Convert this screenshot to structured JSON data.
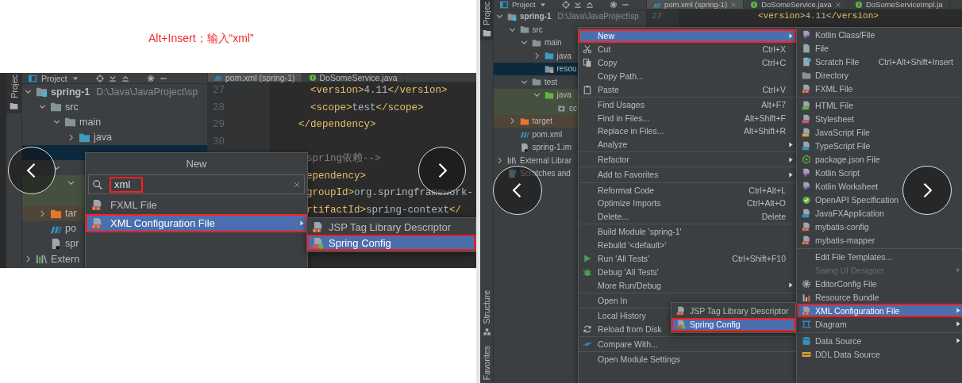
{
  "annotation": "Alt+Insert；输入“xml”",
  "left_screenshot": {
    "tool_window_tabs": [
      {
        "label": "Projec",
        "kind": "project",
        "selected": true
      }
    ],
    "panel_title": "Project",
    "tree": [
      {
        "label": "spring-1",
        "path": "D:\\Java\\JavaProject\\sp",
        "kind": "module",
        "expanded": true,
        "selected": false,
        "children": [
          {
            "label": "src",
            "kind": "folder",
            "expanded": true,
            "selected": false,
            "children": [
              {
                "label": "main",
                "kind": "folder",
                "expanded": true,
                "selected": false,
                "children": [
                  {
                    "label": "java",
                    "kind": "source",
                    "expanded": false,
                    "selected": false
                  },
                  {
                    "selected": true
                  }
                ]
              },
              {
                "expanded": true,
                "selected": false,
                "children": [
                  {
                    "kind": "test-source",
                    "expanded": true,
                    "selected": false,
                    "children": [
                      {
                        "selected": false
                      }
                    ]
                  }
                ]
              }
            ]
          },
          {
            "label": "tar",
            "kind": "excluded",
            "expanded": false,
            "selected": false
          },
          {
            "label": "po",
            "kind": "build-file",
            "selected": false
          },
          {
            "label": "spr",
            "kind": "module-file",
            "selected": false
          }
        ]
      },
      {
        "label": "Extern",
        "kind": "library",
        "expanded": false,
        "selected": false
      }
    ],
    "editor_tabs": [
      {
        "label": "pom.xml (spring-1)",
        "kind": "build-file",
        "selected": true
      },
      {
        "label": "DoSomeService.java",
        "kind": "class",
        "selected": false
      }
    ],
    "line_numbers": [
      "27",
      "28",
      "29",
      "30"
    ],
    "code_lines": [
      {
        "kind": "code",
        "tokens": [
          {
            "text": "  <version>",
            "kind": "tag"
          },
          {
            "text": "4.11",
            "kind": "text"
          },
          {
            "text": "</version>",
            "kind": "tag"
          }
        ]
      },
      {
        "kind": "code",
        "tokens": [
          {
            "text": "  <scope>",
            "kind": "tag"
          },
          {
            "text": "test",
            "kind": "text"
          },
          {
            "text": "</scope>",
            "kind": "tag"
          }
        ]
      },
      {
        "kind": "code",
        "tokens": [
          {
            "text": "</dependency>",
            "kind": "tag"
          }
        ]
      },
      {
        "kind": "blank"
      },
      {
        "kind": "partial",
        "tokens": [
          {
            "text": "spring依赖-->",
            "kind": "comment"
          }
        ]
      },
      {
        "kind": "partial",
        "tokens": [
          {
            "text": "ependency>",
            "kind": "tag"
          }
        ]
      },
      {
        "kind": "partial",
        "tokens": [
          {
            "text": "groupId>",
            "kind": "tag"
          },
          {
            "text": "org.springframework-",
            "kind": "text"
          }
        ]
      },
      {
        "kind": "partial",
        "tokens": [
          {
            "text": "rtifactId>",
            "kind": "tag"
          },
          {
            "text": "spring-context",
            "kind": "text"
          },
          {
            "text": "</",
            "kind": "tag"
          }
        ]
      }
    ],
    "new_popup": {
      "title": "New",
      "search": {
        "value": "xml",
        "outlined": true
      },
      "items": [
        {
          "label": "FXML File",
          "kind": "xml",
          "selected": false
        },
        {
          "label": "XML Configuration File",
          "kind": "xml",
          "submenu": true,
          "selected": true,
          "outlined": true
        }
      ]
    },
    "submenu": {
      "items": [
        {
          "label": "JSP Tag Library Descriptor",
          "kind": "xml",
          "selected": false
        },
        {
          "label": "Spring Config",
          "kind": "spring",
          "selected": true,
          "outlined": true
        }
      ]
    },
    "nav_buttons": [
      {
        "kind": "previous"
      },
      {
        "kind": "next"
      }
    ]
  },
  "right_screenshot": {
    "tool_window_tabs": [
      {
        "label": "Projec",
        "kind": "project",
        "selected": true
      },
      {
        "label": "Structure",
        "kind": "structure",
        "selected": false
      },
      {
        "label": "Favorites",
        "kind": "favorites",
        "selected": false
      }
    ],
    "panel_title": "Project",
    "tree": [
      {
        "label": "spring-1",
        "path": "D:\\Java\\JavaProject\\sp",
        "kind": "module",
        "expanded": true,
        "selected": false,
        "children": [
          {
            "label": "src",
            "kind": "folder",
            "expanded": true,
            "selected": false,
            "children": [
              {
                "label": "main",
                "kind": "folder",
                "expanded": true,
                "selected": false,
                "children": [
                  {
                    "label": "java",
                    "kind": "source",
                    "expanded": false,
                    "selected": false
                  },
                  {
                    "label": "resou",
                    "kind": "resources",
                    "selected": true
                  }
                ]
              },
              {
                "label": "test",
                "kind": "folder",
                "expanded": true,
                "selected": false,
                "children": [
                  {
                    "label": "java",
                    "kind": "test-source",
                    "expanded": true,
                    "selected": false,
                    "children": [
                      {
                        "label": "cc",
                        "kind": "package",
                        "selected": false
                      }
                    ]
                  }
                ]
              }
            ]
          },
          {
            "label": "target",
            "kind": "excluded",
            "expanded": false,
            "selected": false
          },
          {
            "label": "pom.xml",
            "kind": "build-file",
            "selected": false
          },
          {
            "label": "spring-1.im",
            "kind": "module-file",
            "selected": false
          }
        ]
      },
      {
        "label": "External Librar",
        "kind": "library",
        "expanded": false,
        "selected": false
      },
      {
        "label": "Scratches and",
        "kind": "scratches",
        "selected": false
      }
    ],
    "editor_tabs": [
      {
        "label": "pom.xml (spring-1)",
        "kind": "build-file",
        "selected": true,
        "closable": true
      },
      {
        "label": "DoSomeService.java",
        "kind": "class",
        "selected": false,
        "closable": true
      },
      {
        "label": "DoSomeServiceImpl.ja",
        "kind": "class",
        "selected": false
      }
    ],
    "line_numbers": [
      "27"
    ],
    "code_lines": [
      {
        "kind": "code",
        "tokens": [
          {
            "text": "<version>",
            "kind": "tag"
          },
          {
            "text": "4.11",
            "kind": "text"
          },
          {
            "text": "</version>",
            "kind": "tag"
          }
        ]
      }
    ],
    "context_menu": {
      "items": [
        {
          "label": "New",
          "kind": "plain",
          "submenu": true,
          "selected": true,
          "outlined": true
        },
        {
          "label": "Cut",
          "kind": "cut",
          "shortcut": "Ctrl+X",
          "selected": false
        },
        {
          "label": "Copy",
          "kind": "copy",
          "shortcut": "Ctrl+C",
          "selected": false
        },
        {
          "label": "Copy Path...",
          "kind": "plain",
          "selected": false
        },
        {
          "label": "Paste",
          "kind": "paste",
          "shortcut": "Ctrl+V",
          "selected": false
        },
        {
          "kind": "separator"
        },
        {
          "label": "Find Usages",
          "kind": "plain",
          "shortcut": "Alt+F7",
          "selected": false
        },
        {
          "label": "Find in Files...",
          "kind": "plain",
          "shortcut": "Alt+Shift+F",
          "selected": false
        },
        {
          "label": "Replace in Files...",
          "kind": "plain",
          "shortcut": "Alt+Shift+R",
          "selected": false
        },
        {
          "label": "Analyze",
          "kind": "plain",
          "submenu": true,
          "selected": false
        },
        {
          "kind": "separator"
        },
        {
          "label": "Refactor",
          "kind": "plain",
          "submenu": true,
          "selected": false
        },
        {
          "kind": "separator"
        },
        {
          "label": "Add to Favorites",
          "kind": "plain",
          "submenu": true,
          "selected": false
        },
        {
          "kind": "separator"
        },
        {
          "label": "Reformat Code",
          "kind": "plain",
          "shortcut": "Ctrl+Alt+L",
          "selected": false
        },
        {
          "label": "Optimize Imports",
          "kind": "plain",
          "shortcut": "Ctrl+Alt+O",
          "selected": false
        },
        {
          "label": "Delete...",
          "kind": "plain",
          "shortcut": "Delete",
          "selected": false
        },
        {
          "kind": "separator"
        },
        {
          "label": "Build Module 'spring-1'",
          "kind": "plain",
          "selected": false
        },
        {
          "label": "Rebuild '<default>'",
          "kind": "plain",
          "selected": false
        },
        {
          "label": "Run 'All Tests'",
          "kind": "run",
          "shortcut": "Ctrl+Shift+F10",
          "selected": false
        },
        {
          "label": "Debug 'All Tests'",
          "kind": "debug",
          "selected": false
        },
        {
          "label": "More Run/Debug",
          "kind": "plain",
          "submenu": true,
          "selected": false
        },
        {
          "kind": "separator"
        },
        {
          "label": "Open In",
          "kind": "plain",
          "selected": false
        },
        {
          "kind": "separator"
        },
        {
          "label": "Local History",
          "kind": "plain",
          "selected": false
        },
        {
          "label": "Reload from Disk",
          "kind": "reload",
          "selected": false
        },
        {
          "kind": "separator"
        },
        {
          "label": "Compare With...",
          "kind": "compare",
          "selected": false
        },
        {
          "kind": "separator"
        },
        {
          "label": "Open Module Settings",
          "kind": "plain",
          "selected": false
        }
      ]
    },
    "new_submenu": {
      "items": [
        {
          "label": "Kotlin Class/File",
          "kind": "kotlin",
          "selected": false
        },
        {
          "label": "File",
          "kind": "file",
          "selected": false
        },
        {
          "label": "Scratch File",
          "kind": "scratch",
          "shortcut": "Ctrl+Alt+Shift+Insert",
          "selected": false
        },
        {
          "label": "Directory",
          "kind": "folder",
          "selected": false
        },
        {
          "label": "FXML File",
          "kind": "xml",
          "selected": false
        },
        {
          "kind": "separator"
        },
        {
          "label": "HTML File",
          "kind": "html",
          "selected": false
        },
        {
          "label": "Stylesheet",
          "kind": "css",
          "selected": false
        },
        {
          "label": "JavaScript File",
          "kind": "js",
          "selected": false
        },
        {
          "label": "TypeScript File",
          "kind": "ts",
          "selected": false
        },
        {
          "label": "package.json File",
          "kind": "json",
          "selected": false
        },
        {
          "label": "Kotlin Script",
          "kind": "kotlin",
          "selected": false
        },
        {
          "label": "Kotlin Worksheet",
          "kind": "kotlin",
          "selected": false
        },
        {
          "label": "OpenAPI Specification",
          "kind": "openapi",
          "selected": false
        },
        {
          "label": "JavaFXApplication",
          "kind": "javafx",
          "selected": false
        },
        {
          "label": "mybatis-config",
          "kind": "xml",
          "selected": false
        },
        {
          "label": "mybatis-mapper",
          "kind": "xml",
          "selected": false
        },
        {
          "kind": "separator"
        },
        {
          "label": "Edit File Templates...",
          "kind": "plain",
          "selected": false
        },
        {
          "label": "Swing UI Designer",
          "kind": "plain",
          "submenu": true,
          "disabled": true,
          "selected": false
        },
        {
          "label": "EditorConfig File",
          "kind": "gear",
          "selected": false
        },
        {
          "label": "Resource Bundle",
          "kind": "bundle",
          "selected": false
        },
        {
          "label": "XML Configuration File",
          "kind": "xml",
          "submenu": true,
          "selected": true,
          "outlined": true
        },
        {
          "label": "Diagram",
          "kind": "diagram",
          "submenu": true,
          "selected": false
        },
        {
          "kind": "separator"
        },
        {
          "label": "Data Source",
          "kind": "database",
          "submenu": true,
          "selected": false
        },
        {
          "label": "DDL Data Source",
          "kind": "ddl",
          "selected": false
        }
      ]
    },
    "xml_submenu": {
      "items": [
        {
          "label": "JSP Tag Library Descriptor",
          "kind": "xml",
          "selected": false
        },
        {
          "label": "Spring Config",
          "kind": "spring",
          "selected": true,
          "outlined": true
        }
      ]
    },
    "nav_buttons": [
      {
        "kind": "previous"
      },
      {
        "kind": "next"
      }
    ]
  }
}
